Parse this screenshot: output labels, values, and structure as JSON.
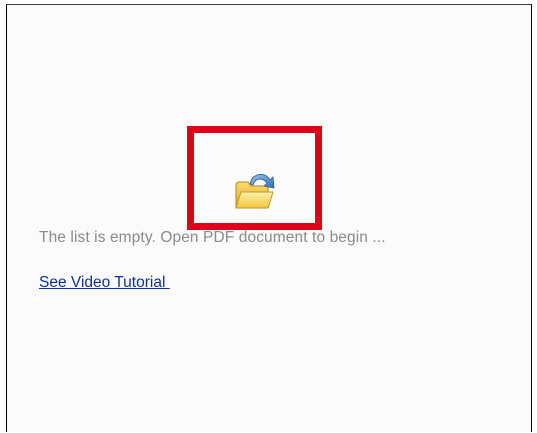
{
  "empty_state": {
    "message": "The list is empty. Open PDF document to begin ...",
    "tutorial_link": "See Video Tutorial ",
    "icon": "open-folder-icon"
  },
  "colors": {
    "highlight": "#e0001b",
    "link": "#0b2fa8",
    "message_text": "#8a8a8a"
  }
}
